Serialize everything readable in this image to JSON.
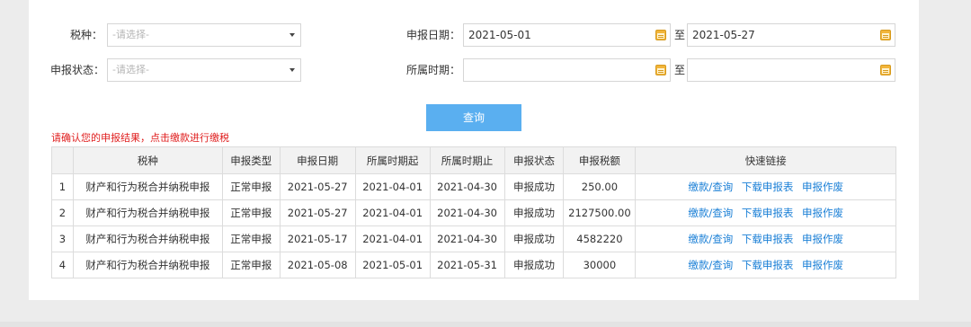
{
  "form": {
    "tax_type_label": "税种：",
    "tax_type_placeholder": "-请选择-",
    "status_label": "申报状态：",
    "status_placeholder": "-请选择-",
    "declare_date_label": "申报日期：",
    "declare_date_from": "2021-05-01",
    "declare_date_to": "2021-05-27",
    "period_label": "所属时期：",
    "period_from": "",
    "period_to": "",
    "to_text": "至",
    "query_button": "查询"
  },
  "notice": "请确认您的申报结果，点击缴款进行缴税",
  "table": {
    "headers": [
      "",
      "税种",
      "申报类型",
      "申报日期",
      "所属时期起",
      "所属时期止",
      "申报状态",
      "申报税额",
      "快速链接"
    ],
    "rows": [
      {
        "idx": "1",
        "tax": "财产和行为税合并纳税申报",
        "type": "正常申报",
        "date": "2021-05-27",
        "start": "2021-04-01",
        "end": "2021-04-30",
        "status": "申报成功",
        "amount": "250.00",
        "pay": "缴款/查询",
        "download": "下载申报表",
        "void": "申报作废"
      },
      {
        "idx": "2",
        "tax": "财产和行为税合并纳税申报",
        "type": "正常申报",
        "date": "2021-05-27",
        "start": "2021-04-01",
        "end": "2021-04-30",
        "status": "申报成功",
        "amount": "2127500.00",
        "pay": "缴款/查询",
        "download": "下载申报表",
        "void": "申报作废"
      },
      {
        "idx": "3",
        "tax": "财产和行为税合并纳税申报",
        "type": "正常申报",
        "date": "2021-05-17",
        "start": "2021-04-01",
        "end": "2021-04-30",
        "status": "申报成功",
        "amount": "4582220",
        "pay": "缴款/查询",
        "download": "下载申报表",
        "void": "申报作废"
      },
      {
        "idx": "4",
        "tax": "财产和行为税合并纳税申报",
        "type": "正常申报",
        "date": "2021-05-08",
        "start": "2021-05-01",
        "end": "2021-05-31",
        "status": "申报成功",
        "amount": "30000",
        "pay": "缴款/查询",
        "download": "下载申报表",
        "void": "申报作废"
      }
    ]
  }
}
